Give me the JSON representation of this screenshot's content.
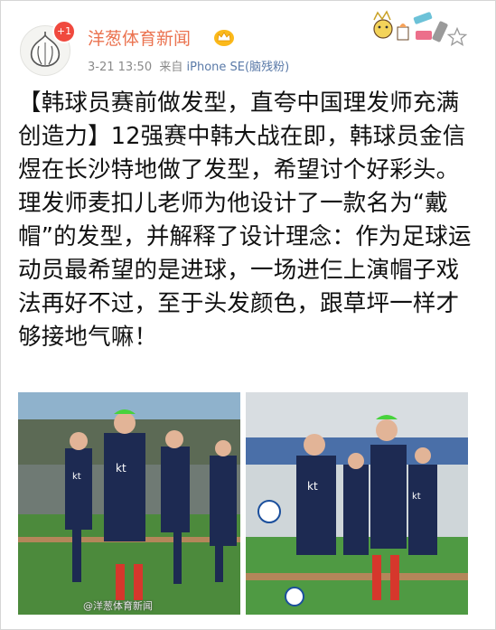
{
  "post": {
    "username": "洋葱体育新闻",
    "badge_count": "+1",
    "time": "3-21 13:50",
    "source_prefix": "来自",
    "source": "iPhone SE(脑残粉)",
    "text": "【韩球员赛前做发型，直夸中国理发师充满创造力】12强赛中韩大战在即，韩球员金信煜在长沙特地做了发型，希望讨个好彩头。理发师麦扣儿老师为他设计了一款名为“戴帽”的发型，并解释了设计理念：作为足球运动员最希望的是进球，一场进仨上演帽子戏法再好不过，至于头发颜色，跟草坪一样才够接地气嘛！",
    "watermark": "@洋葱体育新闻"
  },
  "icons": {
    "avatar": "onion-avatar-icon",
    "verified": "crown-icon",
    "decoration": "sticker-decoration-icon",
    "favorite": "star-outline-icon"
  },
  "photos": [
    {
      "subject": "team-training-photo",
      "kit_text": "kt"
    },
    {
      "subject": "player-with-ball-photo",
      "kit_text": "kt"
    }
  ],
  "colors": {
    "username": "#eb7350",
    "meta": "#8a8a8a",
    "source": "#5a7aa8",
    "badge": "#f0493e",
    "pitch": "#4c8a3c",
    "kit": "#1d2a52",
    "socks": "#d6372c"
  }
}
